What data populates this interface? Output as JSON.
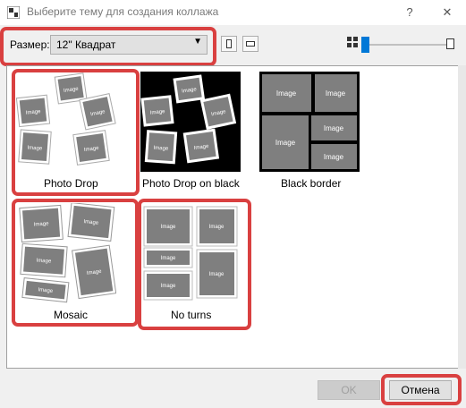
{
  "window": {
    "title": "Выберите тему для создания коллажа",
    "help_glyph": "?",
    "close_glyph": "✕"
  },
  "toolbar": {
    "size_label": "Размер:",
    "size_value": "12\" Квадрат",
    "dropdown_glyph": "▼"
  },
  "themes": [
    {
      "label": "Photo Drop",
      "style": "photo-drop",
      "background": "white",
      "highlighted": true
    },
    {
      "label": "Photo Drop on black",
      "style": "photo-drop",
      "background": "black",
      "highlighted": false
    },
    {
      "label": "Black border",
      "style": "black-border",
      "background": "black",
      "highlighted": false
    },
    {
      "label": "Mosaic",
      "style": "mosaic",
      "background": "white",
      "highlighted": true
    },
    {
      "label": "No turns",
      "style": "no-turns",
      "background": "white",
      "highlighted": true
    }
  ],
  "thumb_text": "Image",
  "buttons": {
    "ok_label": "OK",
    "cancel_label": "Отмена"
  },
  "colors": {
    "highlight_red": "#d94040",
    "slider_blue": "#0078d7",
    "photo_gray": "#7f7f7f"
  }
}
